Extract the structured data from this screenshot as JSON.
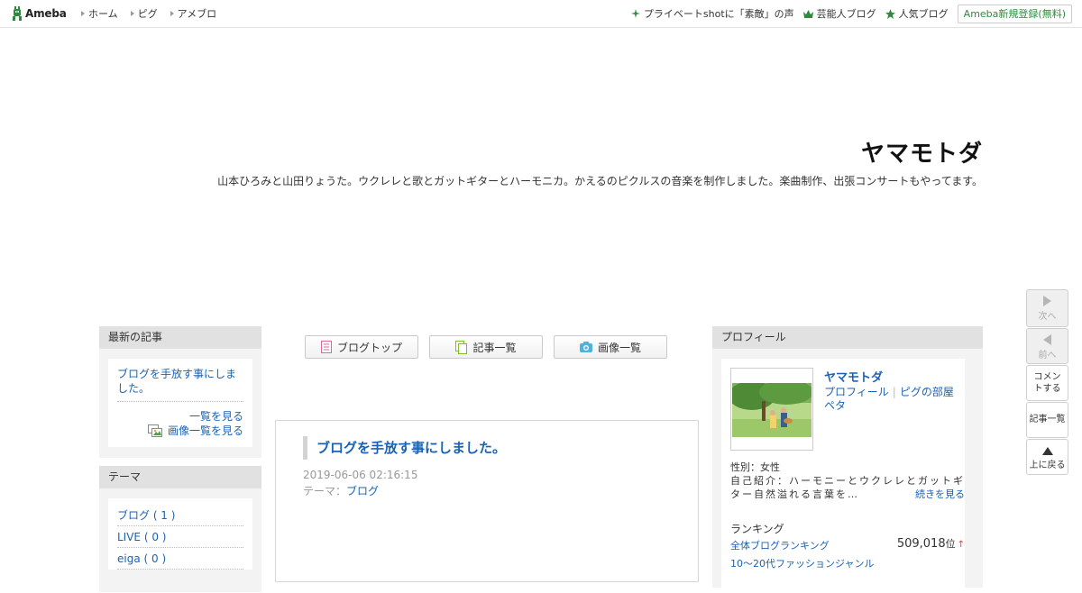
{
  "global_nav": {
    "logo": "Ameba",
    "links": [
      "ホーム",
      "ピグ",
      "アメブロ"
    ],
    "right_links": [
      {
        "label": "プライベートshotに「素敵」の声",
        "icon": "sparkle-icon"
      },
      {
        "label": "芸能人ブログ",
        "icon": "crown-icon"
      },
      {
        "label": "人気ブログ",
        "icon": "star-icon"
      }
    ],
    "register_button": "Ameba新規登録(無料)"
  },
  "header": {
    "blog_title": "ヤマモトダ",
    "description": "山本ひろみと山田りょうた。ウクレレと歌とガットギターとハーモニカ。かえるのピクルスの音楽を制作しました。楽曲制作、出張コンサートもやってます。"
  },
  "left": {
    "recent": {
      "heading": "最新の記事",
      "post": "ブログを手放す事にしました。",
      "view_all": "一覧を見る",
      "view_images": "画像一覧を見る"
    },
    "themes": {
      "heading": "テーマ",
      "items": [
        "ブログ ( 1 )",
        "LIVE ( 0 )",
        "eiga ( 0 )"
      ]
    }
  },
  "tabs": [
    {
      "label": "ブログトップ",
      "icon": "document-icon"
    },
    {
      "label": "記事一覧",
      "icon": "pages-icon"
    },
    {
      "label": "画像一覧",
      "icon": "camera-icon"
    }
  ],
  "article": {
    "title": "ブログを手放す事にしました。",
    "datetime": "2019-06-06 02:16:15",
    "theme_prefix": "テーマ：",
    "theme": "ブログ"
  },
  "profile": {
    "heading": "プロフィール",
    "name": "ヤマモトダ",
    "link_profile": "プロフィール",
    "link_room": "ピグの部屋",
    "link_peta": "ペタ",
    "gender": "性別：女性",
    "intro": "自己紹介：ハーモニーとウクレレとガットギター自然溢れる言葉を…",
    "more": "続きを見る",
    "ranking_heading": "ランキング",
    "ranking_overall": "全体ブログランキング",
    "ranking_value": "509,018",
    "ranking_unit": "位",
    "ranking_trend": "↑",
    "ranking_genre": "10〜20代ファッションジャンル"
  },
  "side_nav": {
    "next": "次へ",
    "prev": "前へ",
    "comment": "コメントする",
    "list": "記事一覧",
    "top": "上に戻る"
  }
}
